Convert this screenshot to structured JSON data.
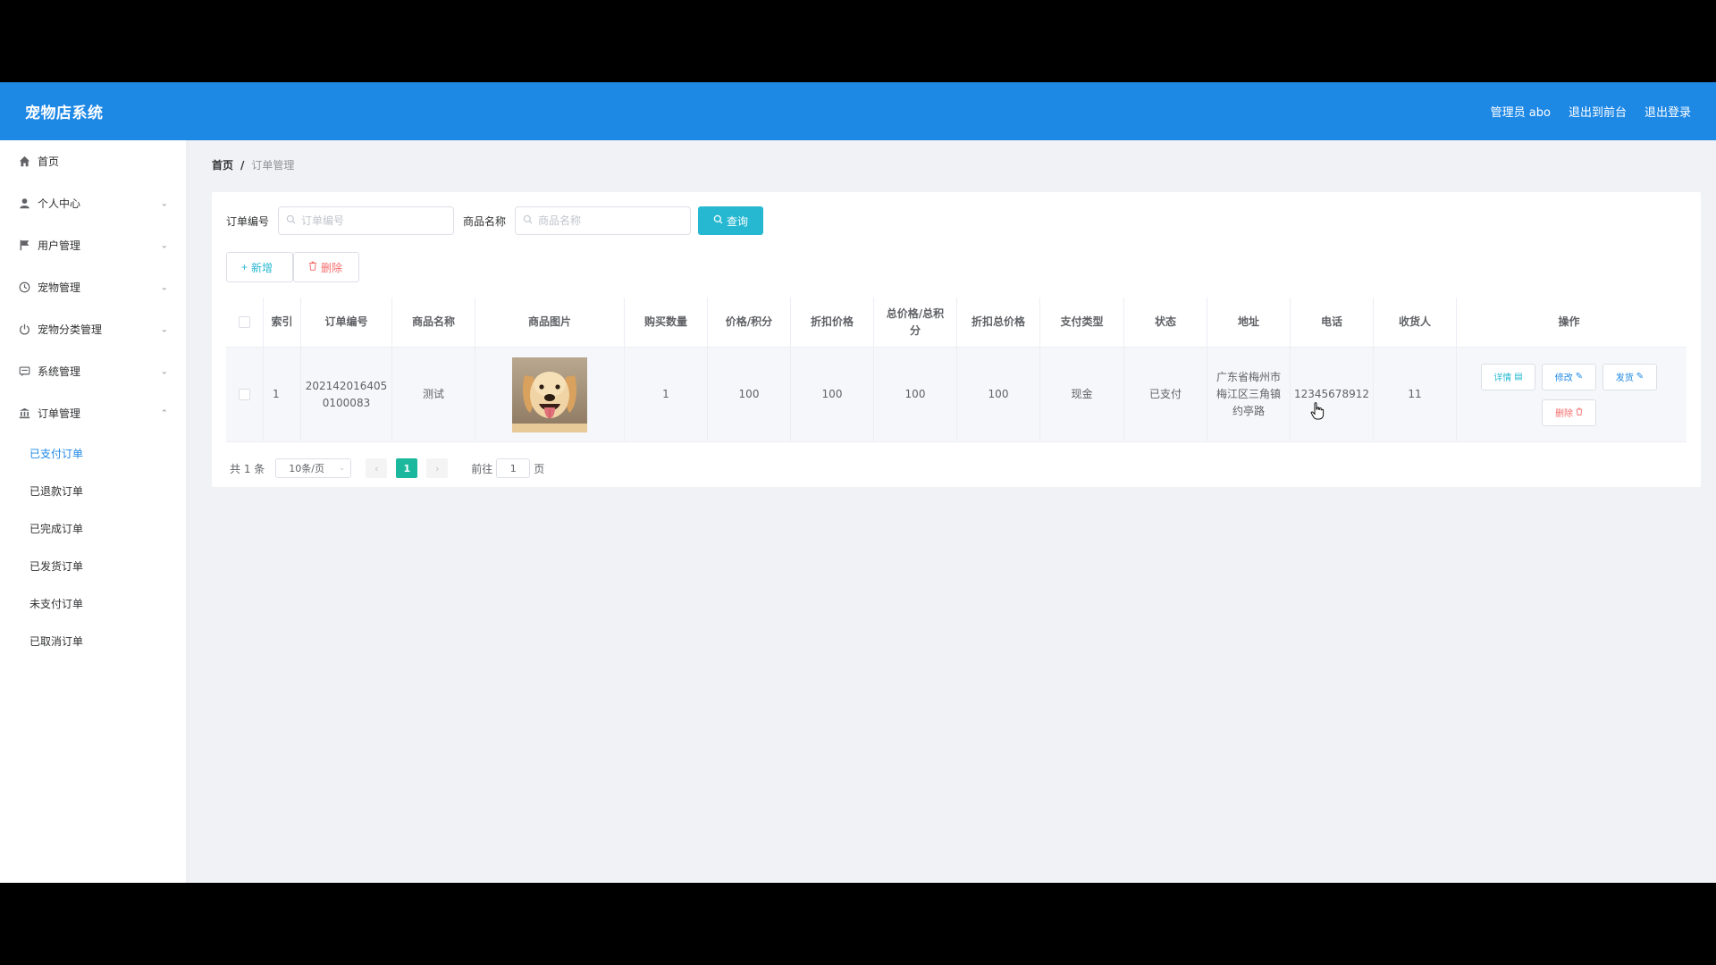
{
  "header": {
    "brand": "宠物店系统",
    "admin_label": "管理员 abo",
    "back_front": "退出到前台",
    "logout": "退出登录",
    "color": "#1e88e5"
  },
  "sidebar": {
    "items": [
      {
        "label": "首页",
        "icon": "home-icon"
      },
      {
        "label": "个人中心",
        "icon": "user-icon"
      },
      {
        "label": "用户管理",
        "icon": "flag-icon"
      },
      {
        "label": "宠物管理",
        "icon": "clock-icon"
      },
      {
        "label": "宠物分类管理",
        "icon": "power-icon"
      },
      {
        "label": "系统管理",
        "icon": "message-icon"
      },
      {
        "label": "订单管理",
        "icon": "bank-icon"
      }
    ],
    "sub_items": [
      "已支付订单",
      "已退款订单",
      "已完成订单",
      "已发货订单",
      "未支付订单",
      "已取消订单"
    ]
  },
  "breadcrumb": {
    "home": "首页",
    "sep": "/",
    "current": "订单管理"
  },
  "search": {
    "order_label": "订单编号",
    "order_placeholder": "订单编号",
    "product_label": "商品名称",
    "product_placeholder": "商品名称",
    "query_button": "查询"
  },
  "actions": {
    "add": "新增",
    "delete": "删除"
  },
  "table": {
    "headers": [
      "索引",
      "订单编号",
      "商品名称",
      "商品图片",
      "购买数量",
      "价格/积分",
      "折扣价格",
      "总价格/总积分",
      "折扣总价格",
      "支付类型",
      "状态",
      "地址",
      "电话",
      "收货人",
      "操作"
    ],
    "rows": [
      {
        "index": "1",
        "order_no": "2021420164050100083",
        "order_no_l1": "202142016405",
        "order_no_l2": "0100083",
        "product": "测试",
        "qty": "1",
        "price": "100",
        "discount_price": "100",
        "total": "100",
        "discount_total": "100",
        "pay_type": "现金",
        "status": "已支付",
        "address_l1": "广东省梅州市",
        "address_l2": "梅江区三角镇",
        "address_l3": "约亭路",
        "phone": "12345678912",
        "receiver": "11"
      }
    ],
    "ops": {
      "view": "详情",
      "edit": "修改",
      "ship": "发货",
      "delete": "删除"
    }
  },
  "pagination": {
    "total": "共 1 条",
    "page_size": "10条/页",
    "current_page": "1",
    "goto_label": "前往",
    "goto_value": "1",
    "page_suffix": "页"
  }
}
